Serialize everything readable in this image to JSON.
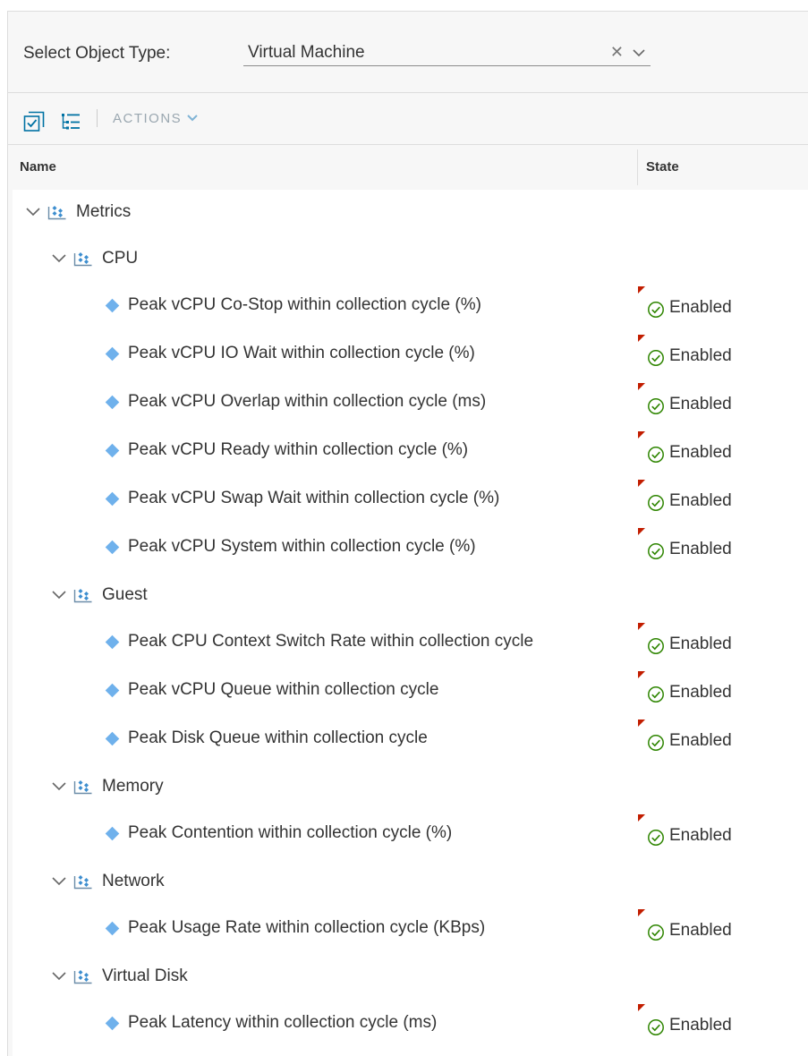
{
  "selector": {
    "label": "Select Object Type:",
    "value": "Virtual Machine"
  },
  "toolbar": {
    "actions_label": "ACTIONS"
  },
  "table": {
    "col_name": "Name",
    "col_state": "State",
    "state_enabled": "Enabled",
    "root": "Metrics",
    "groups": [
      {
        "label": "CPU",
        "items": [
          "Peak vCPU Co-Stop within collection cycle (%)",
          "Peak vCPU IO Wait within collection cycle (%)",
          "Peak vCPU Overlap within collection cycle (ms)",
          "Peak vCPU Ready within collection cycle (%)",
          "Peak vCPU Swap Wait within collection cycle (%)",
          "Peak vCPU System within collection cycle (%)"
        ]
      },
      {
        "label": "Guest",
        "items": [
          "Peak CPU Context Switch Rate within collection cycle",
          "Peak vCPU Queue within collection cycle",
          "Peak Disk Queue within collection cycle"
        ]
      },
      {
        "label": "Memory",
        "items": [
          "Peak Contention within collection cycle (%)"
        ]
      },
      {
        "label": "Network",
        "items": [
          "Peak Usage Rate within collection cycle (KBps)"
        ]
      },
      {
        "label": "Virtual Disk",
        "items": [
          "Peak Latency within collection cycle (ms)"
        ]
      }
    ]
  },
  "colors": {
    "accent": "#0072a3",
    "metric_diamond": "#6fb1ec",
    "enabled_green": "#2e8500",
    "dirty_marker": "#c21d00"
  }
}
